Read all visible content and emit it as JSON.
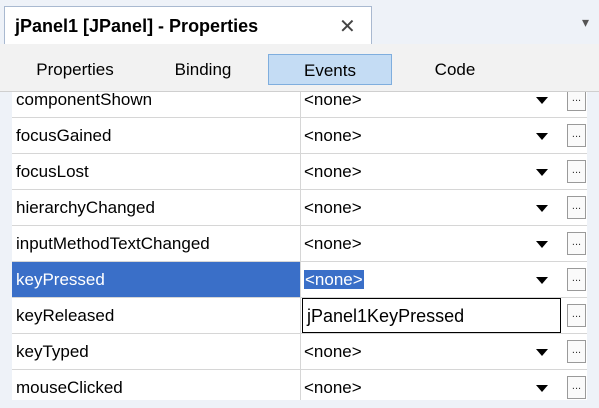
{
  "window": {
    "tab_title": "jPanel1 [JPanel] - Properties",
    "close_glyph": "✕",
    "scroll_glyph": "▾"
  },
  "subtabs": [
    {
      "label": "Properties",
      "active": false
    },
    {
      "label": "Binding",
      "active": false
    },
    {
      "label": "Events",
      "active": true
    },
    {
      "label": "Code",
      "active": false
    }
  ],
  "rows": [
    {
      "name": "componentShown",
      "value": "<none>",
      "state": "normal"
    },
    {
      "name": "focusGained",
      "value": "<none>",
      "state": "normal"
    },
    {
      "name": "focusLost",
      "value": "<none>",
      "state": "normal"
    },
    {
      "name": "hierarchyChanged",
      "value": "<none>",
      "state": "normal"
    },
    {
      "name": "inputMethodTextChanged",
      "value": "<none>",
      "state": "normal"
    },
    {
      "name": "keyPressed",
      "value": "<none>",
      "state": "selected"
    },
    {
      "name": "keyReleased",
      "value": "jPanel1KeyPressed",
      "state": "editing"
    },
    {
      "name": "keyTyped",
      "value": "<none>",
      "state": "normal"
    },
    {
      "name": "mouseClicked",
      "value": "<none>",
      "state": "normal"
    }
  ],
  "ellipsis_label": "...",
  "colors": {
    "selection": "#3a6fc8",
    "active_tab": "#c4dcf4"
  },
  "icons": {
    "close": "close-icon",
    "dropdown": "dropdown-arrow-icon",
    "ellipsis": "ellipsis-button-icon"
  }
}
